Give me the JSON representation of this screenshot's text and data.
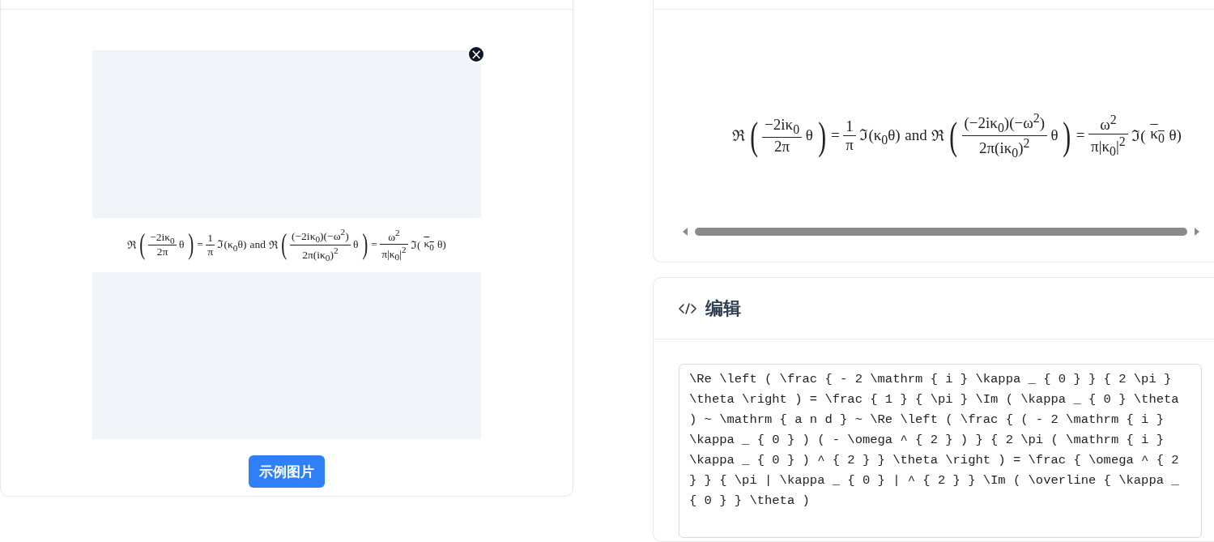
{
  "preview": {
    "kind": "picture",
    "remove_button": "×",
    "formula": [
      {
        "kind": "text",
        "text": "ℜ"
      },
      {
        "kind": "group",
        "open": "(",
        "close": ")",
        "items": [
          {
            "kind": "frac",
            "num": "−2iκ$_{0}$",
            "den": "2π"
          },
          {
            "kind": "text",
            "text": "θ"
          }
        ]
      },
      {
        "kind": "text",
        "text": "="
      },
      {
        "kind": "frac",
        "num": "1",
        "den": "π"
      },
      {
        "kind": "text",
        "text": "ℑ(κ$_{0}$θ)"
      },
      {
        "kind": "text",
        "text": "and"
      },
      {
        "kind": "text",
        "text": "ℜ"
      },
      {
        "kind": "group",
        "open": "(",
        "close": ")",
        "items": [
          {
            "kind": "frac",
            "num": "(−2iκ$_{0}$)(−ω$^{2}$)",
            "den": "2π(iκ$_{0}$)$^{2}$"
          },
          {
            "kind": "text",
            "text": "θ"
          }
        ]
      },
      {
        "kind": "text",
        "text": "="
      },
      {
        "kind": "frac",
        "num": "ω$^{2}$",
        "den": "π|κ$_{0}$|$^{2}$"
      },
      {
        "kind": "text",
        "text": "ℑ("
      },
      {
        "kind": "overline",
        "text": "κ$_{0}$"
      },
      {
        "kind": "text",
        "text": "θ)"
      }
    ],
    "example_button": "示例图片"
  },
  "render": {
    "formula": [
      {
        "kind": "text",
        "text": "ℜ"
      },
      {
        "kind": "group",
        "open": "(",
        "close": ")",
        "items": [
          {
            "kind": "frac",
            "num": "−2iκ$_{0}$",
            "den": "2π"
          },
          {
            "kind": "text",
            "text": "θ"
          }
        ]
      },
      {
        "kind": "text",
        "text": "="
      },
      {
        "kind": "frac",
        "num": "1",
        "den": "π"
      },
      {
        "kind": "text",
        "text": "ℑ(κ$_{0}$θ)"
      },
      {
        "kind": "text",
        "text": "and"
      },
      {
        "kind": "text",
        "text": "ℜ"
      },
      {
        "kind": "group",
        "open": "(",
        "close": ")",
        "items": [
          {
            "kind": "frac",
            "num": "(−2iκ$_{0}$)(−ω$^{2}$)",
            "den": "2π(iκ$_{0}$)$^{2}$"
          },
          {
            "kind": "text",
            "text": "θ"
          }
        ]
      },
      {
        "kind": "text",
        "text": "="
      },
      {
        "kind": "frac",
        "num": "ω$^{2}$",
        "den": "π|κ$_{0}$|$^{2}$"
      },
      {
        "kind": "text",
        "text": "ℑ("
      },
      {
        "kind": "overline",
        "text": "κ$_{0}$"
      },
      {
        "kind": "text",
        "text": "θ)"
      }
    ]
  },
  "editor": {
    "title": "编辑",
    "source": "\\Re \\left ( \\frac { - 2 \\mathrm { i } \\kappa _ { 0 } } { 2 \\pi } \\theta \\right ) = \\frac { 1 } { \\pi } \\Im ( \\kappa _ { 0 } \\theta ) ~ \\mathrm { a n d } ~ \\Re \\left ( \\frac { ( - 2 \\mathrm { i } \\kappa _ { 0 } ) ( - \\omega ^ { 2 } ) } { 2 \\pi ( \\mathrm { i } \\kappa _ { 0 } ) ^ { 2 } } \\theta \\right ) = \\frac { \\omega ^ { 2 } } { \\pi | \\kappa _ { 0 } | ^ { 2 } } \\Im ( \\overline { \\kappa _ { 0 } } \\theta )"
  }
}
